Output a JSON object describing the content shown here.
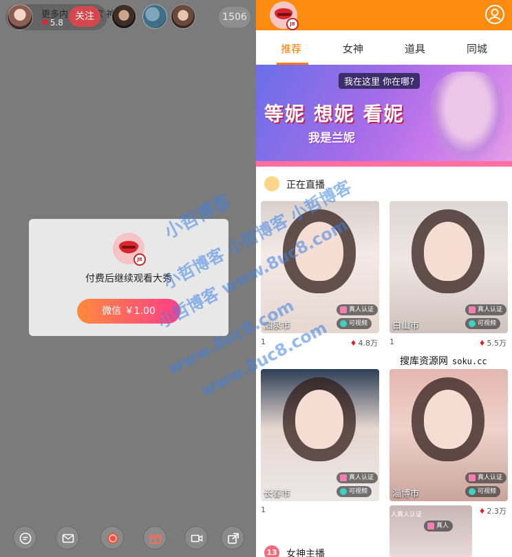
{
  "room": {
    "anchor_heat": "5.8",
    "ticker": "更多内 家 ⓘ 家 神。",
    "follow_label": "关注",
    "audience_count": "1506",
    "paywall_message": "付费后继续观看大秀",
    "pay_label": "微信 ￥1.00",
    "logo_badge": "J8",
    "dock": [
      "chat-icon",
      "mail-icon",
      "game-icon",
      "gift-icon",
      "camera-icon",
      "share-icon"
    ],
    "colors": {
      "follow": "#d6474b",
      "pay_start": "#ff8a3d",
      "pay_end": "#ff3f8a"
    }
  },
  "watermark": {
    "line1": "小哲博客",
    "line2": "小哲博客 小哲博客 小哲博客",
    "line3": "小哲博客 www.8uc8.com",
    "line4": "www.8uc8.com",
    "line5": "www.8uc8.com"
  },
  "app": {
    "logo_badge": "J8",
    "tabs": [
      {
        "label": "推荐",
        "active": true
      },
      {
        "label": "女神",
        "active": false
      },
      {
        "label": "道具",
        "active": false
      },
      {
        "label": "同城",
        "active": false
      }
    ],
    "banner": {
      "tip": "我在这里 你在哪?",
      "headline": "等妮 想妮 看妮",
      "sub": "我是兰妮"
    },
    "live_section": "正在直播",
    "goddess_section": "女神主播",
    "goddess_badge": "13",
    "cards": [
      {
        "city": "泗泉市",
        "rank": "1",
        "heat": "4.8万",
        "verified": "真人认证",
        "video": "可视频"
      },
      {
        "city": "白山市",
        "rank": "1",
        "heat": "5.5万",
        "verified": "真人认证",
        "video": "可视频"
      },
      {
        "city": "长春市",
        "rank": "1",
        "heat": "",
        "verified": "真人认证",
        "video": "可视频"
      },
      {
        "city": "淄博市",
        "rank": "",
        "heat": "2.3万",
        "verified": "真人认证",
        "video": "可视频"
      }
    ],
    "fifth_card": {
      "banner_text": "人真人认证",
      "verified": "真人"
    },
    "brand_mark": "搜库资源网",
    "brand_domain": "soku.cc",
    "colors": {
      "orange": "#fb8c10",
      "accent": "#ff7a00"
    }
  }
}
